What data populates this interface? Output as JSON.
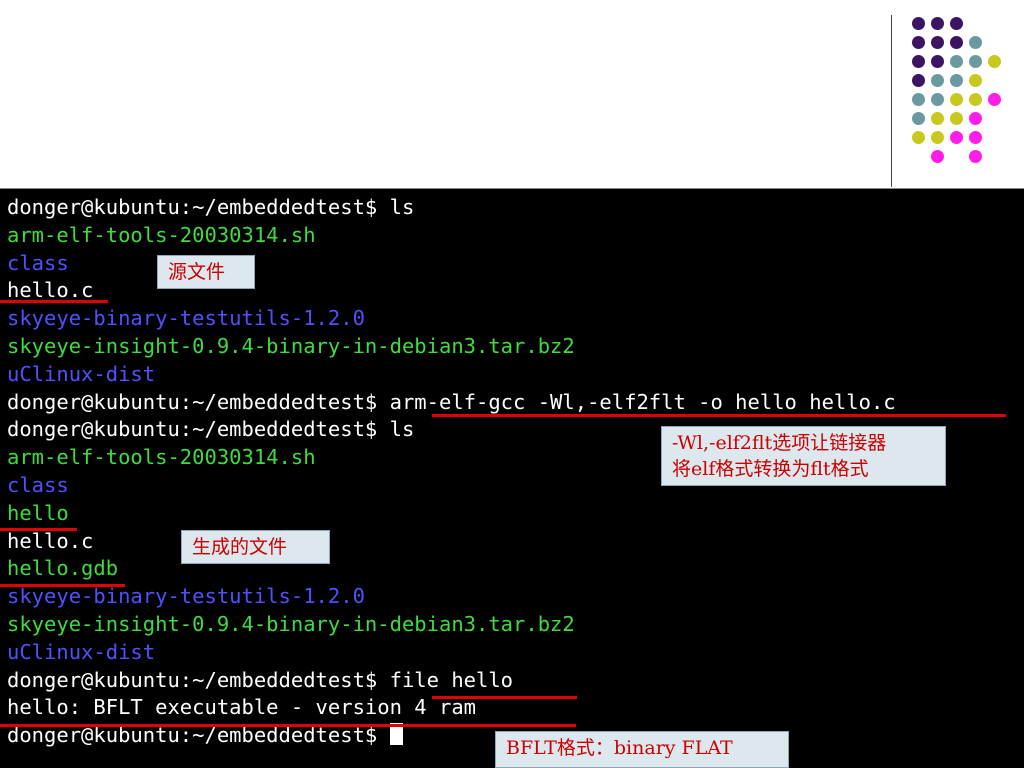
{
  "colors": {
    "prompt": "#ffffff",
    "file": "#ffffff",
    "exec": "#3edc3e",
    "dir": "#5050ff",
    "underline": "#e00000",
    "note_text": "#cc0000",
    "note_bg": "#dde8ee",
    "dot_purple": "#3c1464",
    "dot_teal": "#6a9aa0",
    "dot_yellow": "#c8c81e",
    "dot_magenta": "#ff1ee6"
  },
  "decoration": {
    "dot_grid": [
      [
        "purple",
        "purple",
        "purple",
        null,
        null
      ],
      [
        "purple",
        "purple",
        "purple",
        "teal",
        null
      ],
      [
        "purple",
        "purple",
        "teal",
        "teal",
        "yellow"
      ],
      [
        "purple",
        "teal",
        "teal",
        "yellow",
        null
      ],
      [
        "teal",
        "teal",
        "yellow",
        "yellow",
        "magenta"
      ],
      [
        "teal",
        "yellow",
        "yellow",
        "magenta",
        null
      ],
      [
        "yellow",
        "yellow",
        "magenta",
        "magenta",
        null
      ],
      [
        null,
        "magenta",
        null,
        "magenta",
        null
      ]
    ]
  },
  "terminal": {
    "lines": [
      {
        "text": "donger@kubuntu:~/embeddedtest$ ls",
        "kind": "prompt"
      },
      {
        "text": "arm-elf-tools-20030314.sh",
        "kind": "exec"
      },
      {
        "text": "class",
        "kind": "dir"
      },
      {
        "text": "hello.c",
        "kind": "file"
      },
      {
        "text": "skyeye-binary-testutils-1.2.0",
        "kind": "dir"
      },
      {
        "text": "skyeye-insight-0.9.4-binary-in-debian3.tar.bz2",
        "kind": "exec"
      },
      {
        "text": "uClinux-dist",
        "kind": "dir"
      },
      {
        "text": "donger@kubuntu:~/embeddedtest$ arm-elf-gcc -Wl,-elf2flt -o hello hello.c",
        "kind": "prompt"
      },
      {
        "text": "donger@kubuntu:~/embeddedtest$ ls",
        "kind": "prompt"
      },
      {
        "text": "arm-elf-tools-20030314.sh",
        "kind": "exec"
      },
      {
        "text": "class",
        "kind": "dir"
      },
      {
        "text": "hello",
        "kind": "exec"
      },
      {
        "text": "hello.c",
        "kind": "file"
      },
      {
        "text": "hello.gdb",
        "kind": "exec"
      },
      {
        "text": "skyeye-binary-testutils-1.2.0",
        "kind": "dir"
      },
      {
        "text": "skyeye-insight-0.9.4-binary-in-debian3.tar.bz2",
        "kind": "exec"
      },
      {
        "text": "uClinux-dist",
        "kind": "dir"
      },
      {
        "text": "donger@kubuntu:~/embeddedtest$ file hello",
        "kind": "prompt"
      },
      {
        "text": "hello: BFLT executable - version 4 ram",
        "kind": "file"
      },
      {
        "text": "donger@kubuntu:~/embeddedtest$ ",
        "kind": "prompt",
        "cursor": true
      }
    ]
  },
  "annotations": {
    "source_file": "源文件",
    "wl_option": "-Wl,-elf2flt选项让链接器\n将elf格式转换为flt格式",
    "generated_files": "生成的文件",
    "bflt_format": "BFLT格式：binary FLAT"
  }
}
